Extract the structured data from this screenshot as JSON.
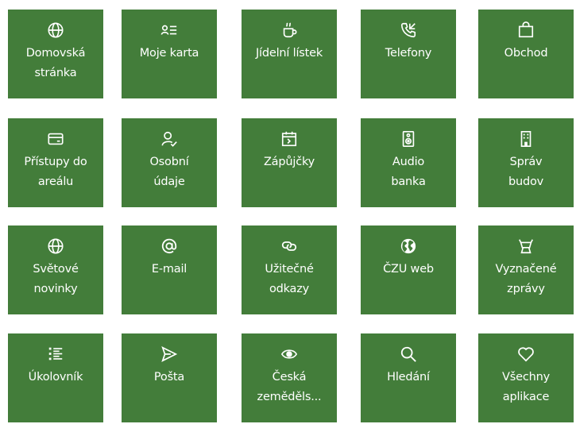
{
  "theme": {
    "tile_color": "#437D3A",
    "text_color": "#FFFFFF"
  },
  "tiles": [
    {
      "label": "Domovská\nstránka",
      "icon": "globe-icon"
    },
    {
      "label": "Moje karta",
      "icon": "id-card-list-icon"
    },
    {
      "label": "Jídelní lístek",
      "icon": "cup-icon"
    },
    {
      "label": "Telefony",
      "icon": "phone-incoming-icon"
    },
    {
      "label": "Obchod",
      "icon": "shopping-bag-icon"
    },
    {
      "label": "Přístupy do\nareálu",
      "icon": "card-icon"
    },
    {
      "label": "Osobní\núdaje",
      "icon": "user-check-icon"
    },
    {
      "label": "Zápůjčky",
      "icon": "calendar-arrow-icon"
    },
    {
      "label": "Audio\nbanka",
      "icon": "speaker-icon"
    },
    {
      "label": "Správ\nbudov",
      "icon": "building-icon"
    },
    {
      "label": "Světové\nnovinky",
      "icon": "globe-icon"
    },
    {
      "label": "E-mail",
      "icon": "at-sign-icon"
    },
    {
      "label": "Užitečné\nodkazy",
      "icon": "link-icon"
    },
    {
      "label": "ČZU web",
      "icon": "earth-icon"
    },
    {
      "label": "Vyznačené\nzprávy",
      "icon": "bull-flag-icon"
    },
    {
      "label": "Úkolovník",
      "icon": "task-list-icon"
    },
    {
      "label": "Pošta",
      "icon": "send-icon"
    },
    {
      "label": "Česká\nzeměděls...",
      "icon": "eye-icon"
    },
    {
      "label": "Hledání",
      "icon": "search-icon"
    },
    {
      "label": "Všechny\naplikace",
      "icon": "heart-icon"
    }
  ]
}
